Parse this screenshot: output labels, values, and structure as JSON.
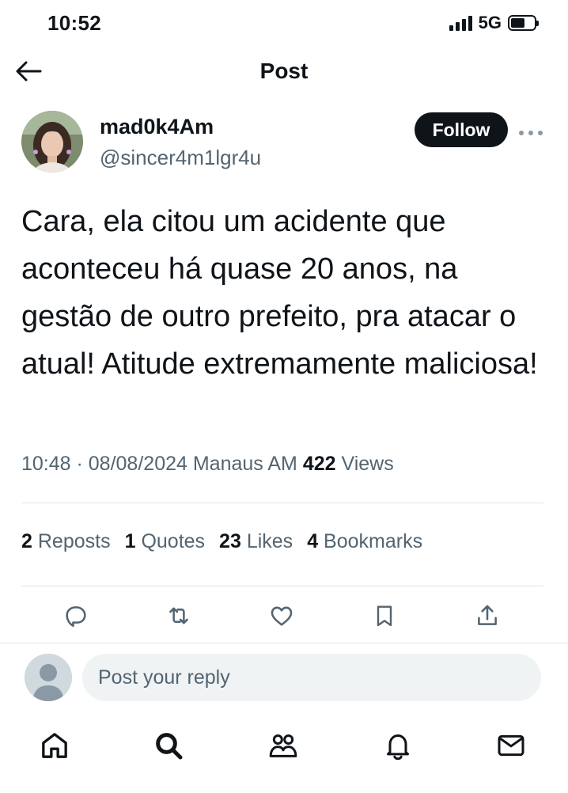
{
  "status_bar": {
    "time": "10:52",
    "network": "5G"
  },
  "header": {
    "title": "Post"
  },
  "author": {
    "name": "mad0k4Am",
    "handle": "@sincer4m1lgr4u",
    "follow_label": "Follow"
  },
  "post": {
    "text": "Cara, ela citou um acidente que aconteceu há quase 20 anos, na gestão de outro prefeito, pra atacar o atual! Atitude extremamente maliciosa!",
    "timestamp": "10:48 · 08/08/2024 Manaus AM",
    "views_count": "422",
    "views_label": "Views"
  },
  "stats": [
    {
      "count": "2",
      "label": "Reposts"
    },
    {
      "count": "1",
      "label": "Quotes"
    },
    {
      "count": "23",
      "label": "Likes"
    },
    {
      "count": "4",
      "label": "Bookmarks"
    }
  ],
  "actions": [
    "reply-icon",
    "repost-icon",
    "like-icon",
    "bookmark-icon",
    "share-icon"
  ],
  "reply": {
    "placeholder": "Post your reply"
  },
  "bottom_nav": [
    "home-icon",
    "search-icon",
    "communities-icon",
    "notifications-icon",
    "messages-icon"
  ],
  "colors": {
    "text": "#0f1419",
    "secondary": "#536471",
    "follow_bg": "#0f1419",
    "input_bg": "#eff3f4",
    "divider": "#dfe3e7"
  }
}
